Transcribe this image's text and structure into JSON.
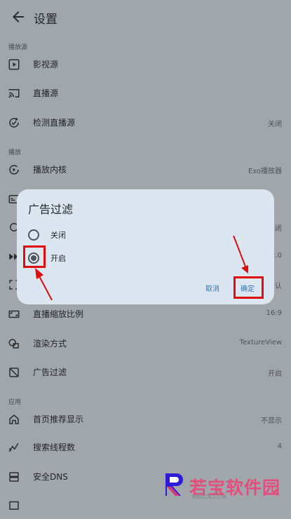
{
  "page": {
    "title": "设置"
  },
  "sections": {
    "playback_source": "播放源",
    "playback": "播放",
    "application": "应用"
  },
  "rows": {
    "video_source": {
      "label": "影视源",
      "value": ""
    },
    "live_source": {
      "label": "直播源",
      "value": ""
    },
    "detect_live_source": {
      "label": "检测直播源",
      "value": "关闭"
    },
    "player_core": {
      "label": "播放内核",
      "value": "Exo播放器"
    },
    "live_scale": {
      "label": "直播缩放比例",
      "value": "16:9"
    },
    "render_mode": {
      "label": "渲染方式",
      "value": "TextureView"
    },
    "ad_filter": {
      "label": "广告过滤",
      "value": "开启"
    },
    "home_recommend": {
      "label": "首页推荐显示",
      "value": "不显示"
    },
    "search_threads": {
      "label": "搜索线程数",
      "value": "4"
    },
    "secure_dns": {
      "label": "安全DNS",
      "value": ""
    }
  },
  "hidden_values": {
    "row_5": "闭",
    "row_6": "2.0",
    "row_7": "认"
  },
  "dialog": {
    "title": "广告过滤",
    "options": [
      {
        "label": "关闭",
        "selected": false
      },
      {
        "label": "开启",
        "selected": true
      }
    ],
    "cancel": "取消",
    "confirm": "确定"
  },
  "watermark": {
    "text": "若宝软件园",
    "sub": "RBSCN.COM"
  },
  "colors": {
    "highlight": "#e00d0d",
    "accent": "#3178b5",
    "overlay_bg": "#a1a6aa",
    "dialog_bg": "#dbe6f0"
  },
  "icons": {
    "back": "arrow-left-icon",
    "video_source": "play-box-icon",
    "live_source": "cast-icon",
    "detect": "check-refresh-icon",
    "player_core": "play-circle-icon",
    "live_scale": "aspect-icon",
    "render": "layers-icon",
    "ad_filter": "block-icon",
    "home": "home-icon",
    "search_threads": "chart-icon",
    "dns": "server-icon"
  }
}
